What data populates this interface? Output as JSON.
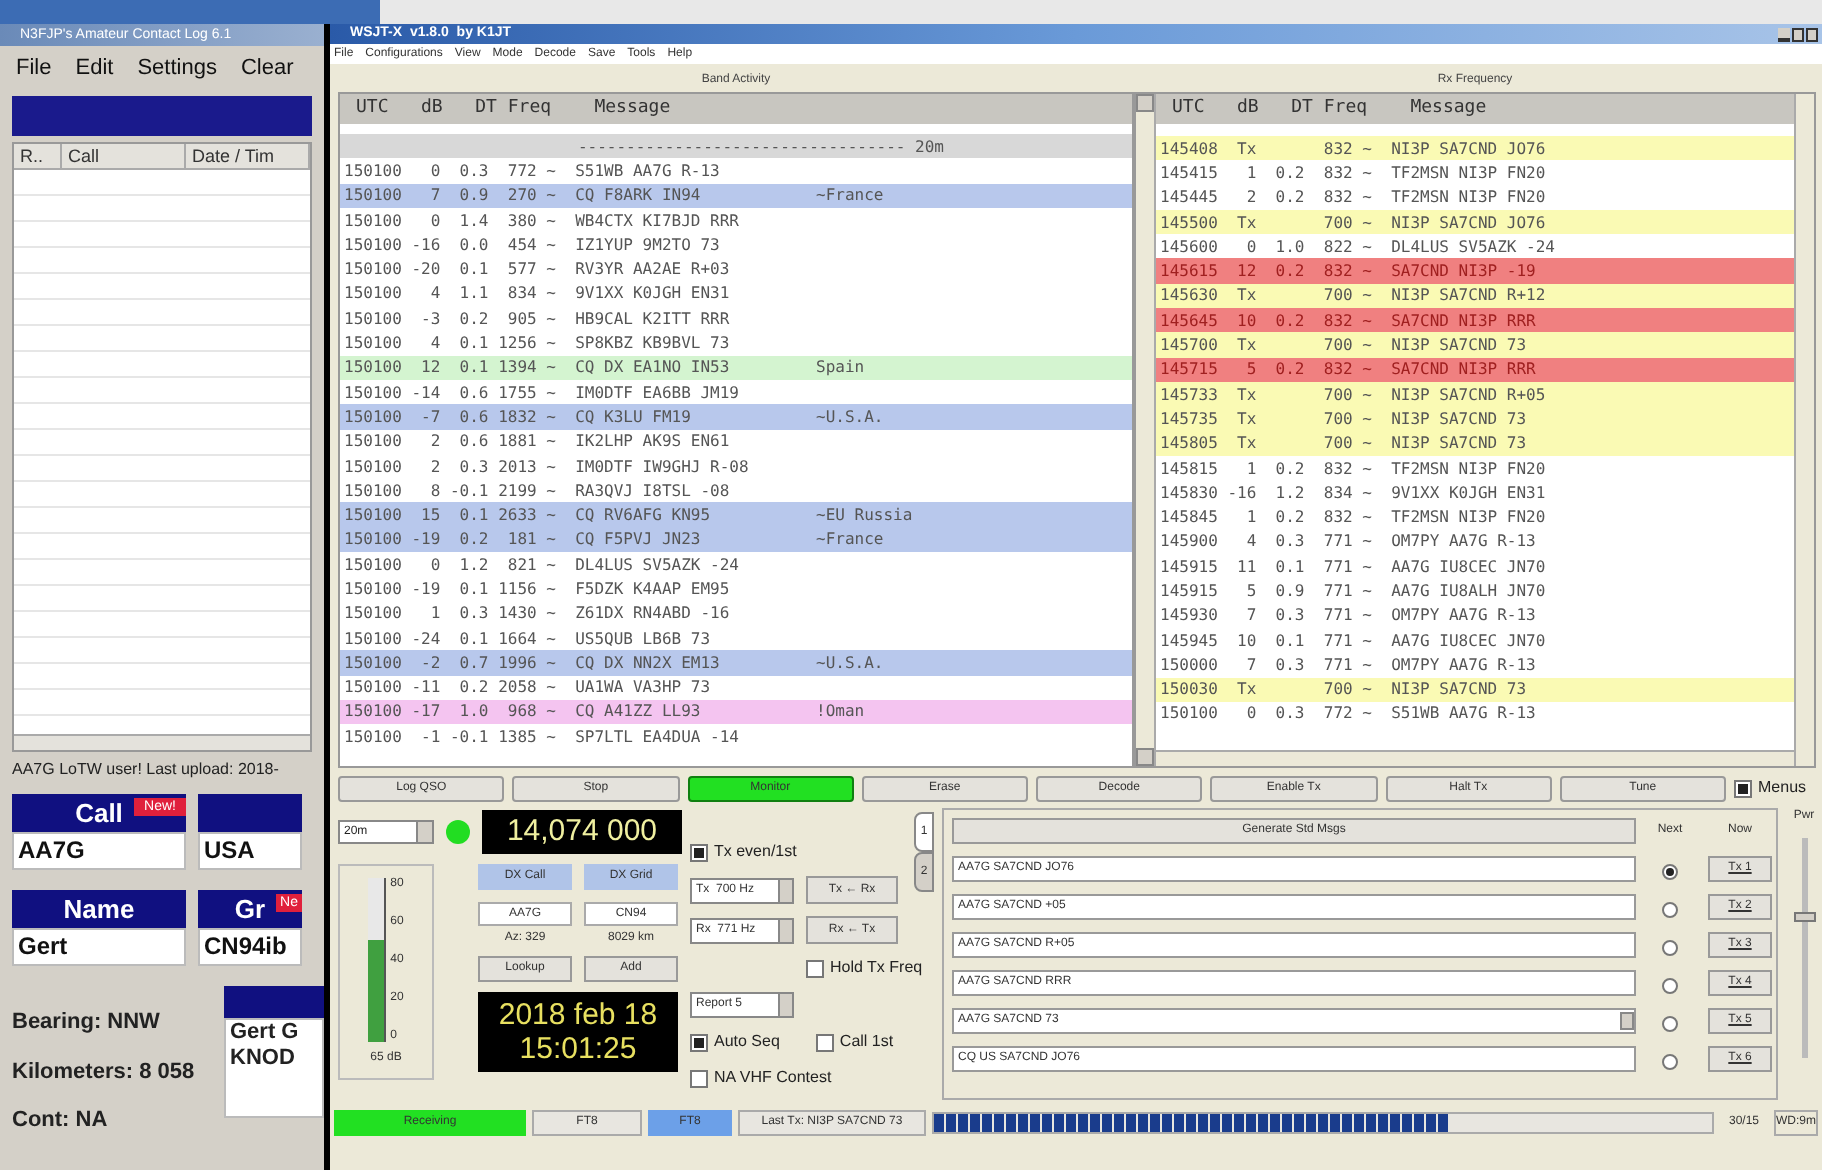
{
  "log_window": {
    "title": "N3FJP's Amateur Contact Log 6.1",
    "menu": [
      "File",
      "Edit",
      "Settings",
      "Clear"
    ],
    "columns": [
      "R..",
      "Call",
      "Date / Tim"
    ],
    "status": "AA7G LoTW user!  Last upload: 2018-",
    "fields": [
      {
        "label": "Call",
        "badge": "New!",
        "value": "AA7G"
      },
      {
        "value": "USA"
      },
      {
        "label": "Name",
        "value": "Gert"
      },
      {
        "label": "Gr",
        "badge": "Ne",
        "value": "CN94ib"
      }
    ],
    "info": [
      "Bearing: NNW",
      "Kilometers: 8 058",
      "Cont: NA"
    ],
    "notes": [
      "Gert G",
      "KNOD"
    ]
  },
  "wsjt_window": {
    "title": "WSJT-X  v1.8.0  by K1JT",
    "menu": [
      "File",
      "Configurations",
      "View",
      "Mode",
      "Decode",
      "Save",
      "Tools",
      "Help"
    ],
    "band_activity": {
      "heading": "Band Activity",
      "header": "UTC   dB   DT Freq    Message",
      "rows": [
        {
          "kind": "separator",
          "text": "---------------------------------- 20m"
        },
        {
          "text": "150100   0  0.3  772 ~  S51WB AA7G R-13"
        },
        {
          "text": "150100   7  0.9  270 ~  CQ F8ARK IN94",
          "note": "~France",
          "color": "#b8c8ec"
        },
        {
          "text": "150100   0  1.4  380 ~  WB4CTX KI7BJD RRR"
        },
        {
          "text": "150100 -16  0.0  454 ~  IZ1YUP 9M2TO 73"
        },
        {
          "text": "150100 -20  0.1  577 ~  RV3YR AA2AE R+03"
        },
        {
          "text": "150100   4  1.1  834 ~  9V1XX K0JGH EN31"
        },
        {
          "text": "150100  -3  0.2  905 ~  HB9CAL K2ITT RRR"
        },
        {
          "text": "150100   4  0.1 1256 ~  SP8KBZ KB9BVL 73"
        },
        {
          "text": "150100  12  0.1 1394 ~  CQ DX EA1NO IN53",
          "note": "Spain",
          "color": "#d4f4d0"
        },
        {
          "text": "150100 -14  0.6 1755 ~  IM0DTF EA6BB JM19"
        },
        {
          "text": "150100  -7  0.6 1832 ~  CQ K3LU FM19",
          "note": "~U.S.A.",
          "color": "#b8c8ec"
        },
        {
          "text": "150100   2  0.6 1881 ~  IK2LHP AK9S EN61"
        },
        {
          "text": "150100   2  0.3 2013 ~  IM0DTF IW9GHJ R-08"
        },
        {
          "text": "150100   8 -0.1 2199 ~  RA3QVJ I8TSL -08"
        },
        {
          "text": "150100  15  0.1 2633 ~  CQ RV6AFG KN95",
          "note": "~EU Russia",
          "color": "#b8c8ec"
        },
        {
          "text": "150100 -19  0.2  181 ~  CQ F5PVJ JN23",
          "note": "~France",
          "color": "#b8c8ec"
        },
        {
          "text": "150100   0  1.2  821 ~  DL4LUS SV5AZK -24"
        },
        {
          "text": "150100 -19  0.1 1156 ~  F5DZK K4AAP EM95"
        },
        {
          "text": "150100   1  0.3 1430 ~  Z61DX RN4ABD -16"
        },
        {
          "text": "150100 -24  0.1 1664 ~  US5QUB LB6B 73"
        },
        {
          "text": "150100  -2  0.7 1996 ~  CQ DX NN2X EM13",
          "note": "~U.S.A.",
          "color": "#b8c8ec"
        },
        {
          "text": "150100 -11  0.2 2058 ~  UA1WA VA3HP 73"
        },
        {
          "text": "150100 -17  1.0  968 ~  CQ A41ZZ LL93",
          "note": "!Oman",
          "color": "#f4c4f0"
        },
        {
          "text": "150100  -1 -0.1 1385 ~  SP7LTL EA4DUA -14"
        }
      ]
    },
    "rx_frequency": {
      "heading": "Rx Frequency",
      "header": "UTC   dB   DT Freq    Message",
      "rows": [
        {
          "text": "145408  Tx       832 ~  NI3P SA7CND JO76",
          "color": "#fafab4"
        },
        {
          "text": "145415   1  0.2  832 ~  TF2MSN NI3P FN20"
        },
        {
          "text": "145445   2  0.2  832 ~  TF2MSN NI3P FN20"
        },
        {
          "text": "145500  Tx       700 ~  NI3P SA7CND JO76",
          "color": "#fafab4"
        },
        {
          "text": "145600   0  1.0  822 ~  DL4LUS SV5AZK -24"
        },
        {
          "text": "145615  12  0.2  832 ~  SA7CND NI3P -19",
          "color": "#f08080"
        },
        {
          "text": "145630  Tx       700 ~  NI3P SA7CND R+12",
          "color": "#fafab4"
        },
        {
          "text": "145645  10  0.2  832 ~  SA7CND NI3P RRR",
          "color": "#f08080"
        },
        {
          "text": "145700  Tx       700 ~  NI3P SA7CND 73",
          "color": "#fafab4"
        },
        {
          "text": "145715   5  0.2  832 ~  SA7CND NI3P RRR",
          "color": "#f08080"
        },
        {
          "text": "145733  Tx       700 ~  NI3P SA7CND R+05",
          "color": "#fafab4"
        },
        {
          "text": "145735  Tx       700 ~  NI3P SA7CND 73",
          "color": "#fafab4"
        },
        {
          "text": "145805  Tx       700 ~  NI3P SA7CND 73",
          "color": "#fafab4"
        },
        {
          "text": "145815   1  0.2  832 ~  TF2MSN NI3P FN20"
        },
        {
          "text": "145830 -16  1.2  834 ~  9V1XX K0JGH EN31"
        },
        {
          "text": "145845   1  0.2  832 ~  TF2MSN NI3P FN20"
        },
        {
          "text": "145900   4  0.3  771 ~  OM7PY AA7G R-13"
        },
        {
          "text": "145915  11  0.1  771 ~  AA7G IU8CEC JN70"
        },
        {
          "text": "145915   5  0.9  771 ~  AA7G IU8ALH JN70"
        },
        {
          "text": "145930   7  0.3  771 ~  OM7PY AA7G R-13"
        },
        {
          "text": "145945  10  0.1  771 ~  AA7G IU8CEC JN70"
        },
        {
          "text": "150000   7  0.3  771 ~  OM7PY AA7G R-13"
        },
        {
          "text": "150030  Tx       700 ~  NI3P SA7CND 73",
          "color": "#fafab4"
        },
        {
          "text": "150100   0  0.3  772 ~  S51WB AA7G R-13"
        }
      ]
    },
    "buttons": [
      {
        "label": "Log QSO",
        "on": false
      },
      {
        "label": "Stop",
        "on": false
      },
      {
        "label": "Monitor",
        "on": true
      },
      {
        "label": "Erase",
        "on": false
      },
      {
        "label": "Decode",
        "on": false
      },
      {
        "label": "Enable Tx",
        "on": false
      },
      {
        "label": "Halt Tx",
        "on": false
      },
      {
        "label": "Tune",
        "on": false
      }
    ],
    "menus_toggle": {
      "label": "Menus",
      "checked": true
    },
    "band": "20m",
    "frequency": "14,074 000",
    "meter": {
      "ticks": [
        "80",
        "60",
        "40",
        "20",
        "0"
      ],
      "level": 0.62,
      "reading": "65 dB"
    },
    "dx": {
      "call_label": "DX Call",
      "grid_label": "DX Grid",
      "call": "AA7G",
      "grid": "CN94",
      "azimuth": "Az: 329",
      "distance": "8029 km",
      "lookup": "Lookup",
      "add": "Add"
    },
    "date": "2018 feb 18",
    "time": "15:01:25",
    "options": [
      {
        "label": "Tx even/1st",
        "checked": true
      }
    ],
    "tx_freq": "Tx  700 Hz",
    "rx_freq": "Rx  771 Hz",
    "tx_from_rx": "Tx ← Rx",
    "rx_from_tx": "Rx ← Tx",
    "hold_tx": {
      "label": "Hold Tx Freq",
      "checked": false
    },
    "report": "Report 5",
    "auto_seq": {
      "label": "Auto Seq",
      "checked": true
    },
    "call_1st": {
      "label": "Call 1st",
      "checked": false
    },
    "na_vhf": {
      "label": "NA VHF Contest",
      "checked": false
    },
    "tabs": [
      {
        "label": "1",
        "selected": true
      },
      {
        "label": "2",
        "selected": false
      }
    ],
    "generate": "Generate Std Msgs",
    "next_label": "Next",
    "now_label": "Now",
    "messages": [
      {
        "text": "AA7G SA7CND JO76",
        "selected": true,
        "button": "Tx 1"
      },
      {
        "text": "AA7G SA7CND +05",
        "selected": false,
        "button": "Tx 2"
      },
      {
        "text": "AA7G SA7CND R+05",
        "selected": false,
        "button": "Tx 3"
      },
      {
        "text": "AA7G SA7CND RRR",
        "selected": false,
        "button": "Tx 4"
      },
      {
        "text": "AA7G SA7CND 73",
        "selected": false,
        "button": "Tx 5",
        "kind": "dropdown"
      },
      {
        "text": "CQ US SA7CND JO76",
        "selected": false,
        "button": "Tx 6"
      }
    ],
    "power": {
      "label": "Pwr",
      "level": 0.62
    },
    "status_bar": {
      "state": "Receiving",
      "mode": "FT8",
      "tx_mode": "FT8",
      "last_tx": "Last Tx: NI3P SA7CND 73",
      "progress": {
        "level": 0.66
      },
      "period": "30/15",
      "watchdog": "WD:9m"
    }
  }
}
